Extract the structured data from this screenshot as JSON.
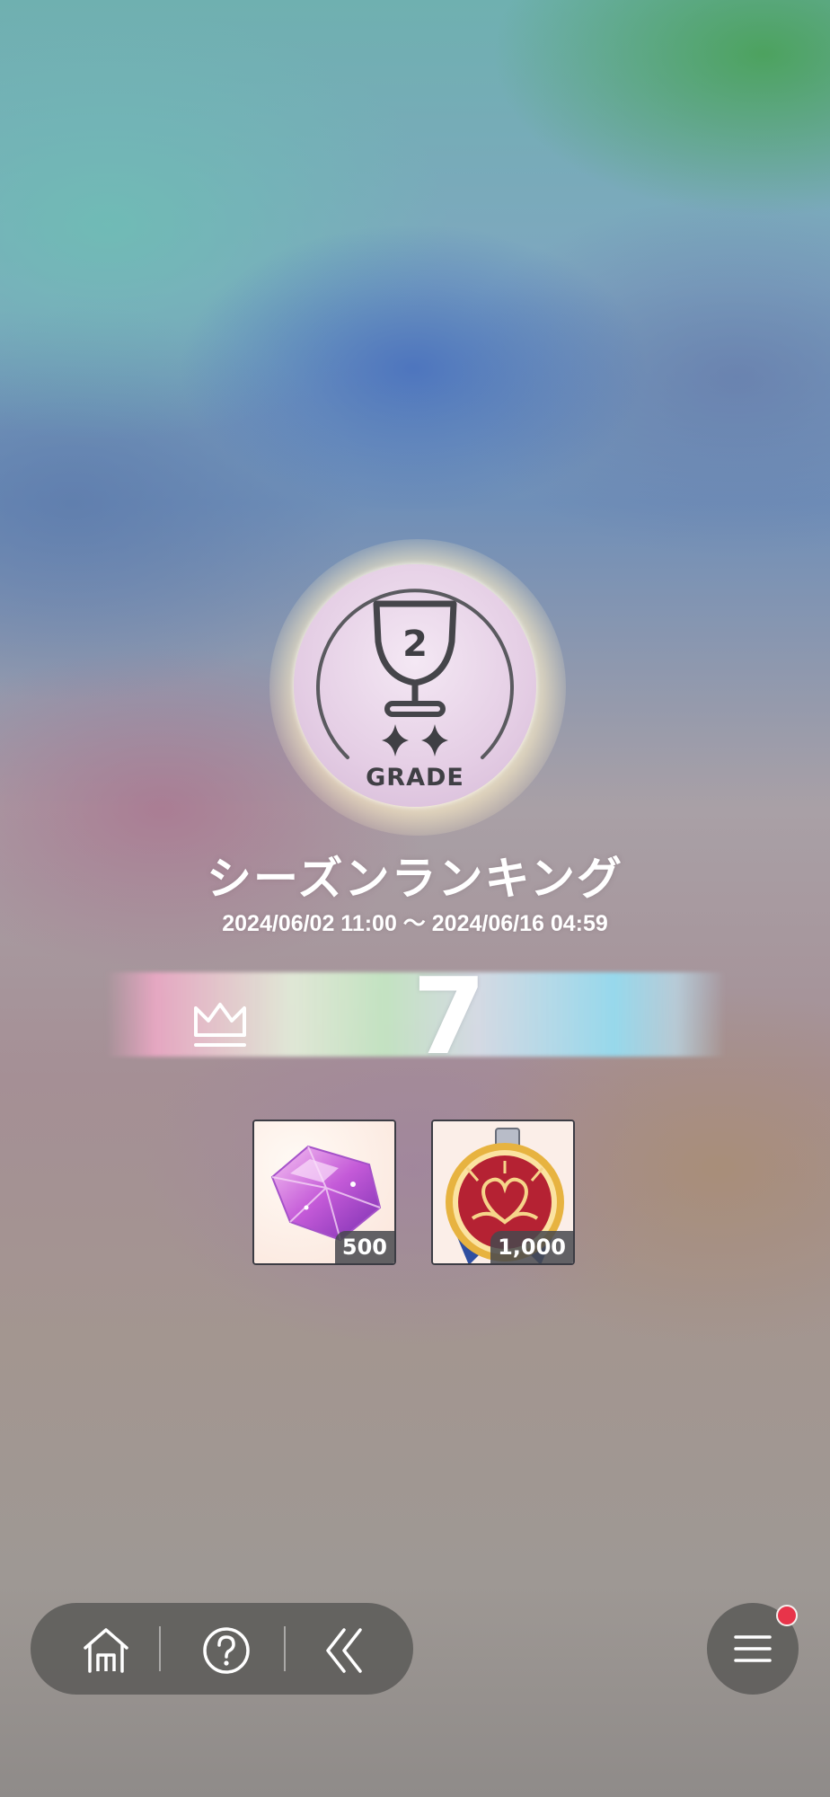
{
  "grade": {
    "number": "2",
    "label": "GRADE",
    "stars": 2,
    "badge_color": "#e4cde4"
  },
  "season": {
    "title": "シーズンランキング",
    "period": "2024/06/02 11:00 ～ 2024/06/16 04:59"
  },
  "rank": {
    "icon": "crown-icon",
    "value": "7"
  },
  "rewards": [
    {
      "icon": "purple-gem-icon",
      "quantity": "500"
    },
    {
      "icon": "heart-medal-icon",
      "quantity": "1,000"
    }
  ],
  "nav": {
    "home_icon": "home-icon",
    "help_icon": "help-icon",
    "back_icon": "back-icon",
    "menu_icon": "menu-icon",
    "menu_has_notification": true,
    "notification_color": "#e8344a"
  }
}
